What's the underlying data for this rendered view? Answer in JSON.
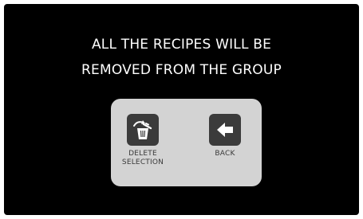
{
  "dialog": {
    "message_line1": "ALL THE RECIPES WILL BE",
    "message_line2": "REMOVED FROM THE GROUP"
  },
  "actions": {
    "delete": {
      "label_line1": "DELETE",
      "label_line2": "SELECTION",
      "icon": "trash-with-arrow-icon"
    },
    "back": {
      "label": "BACK",
      "icon": "arrow-left-icon"
    }
  },
  "colors": {
    "background": "#000000",
    "text": "#ffffff",
    "panel": "#d3d3d3",
    "icon_tile": "#3b3b3b",
    "label": "#3a3a3a"
  }
}
